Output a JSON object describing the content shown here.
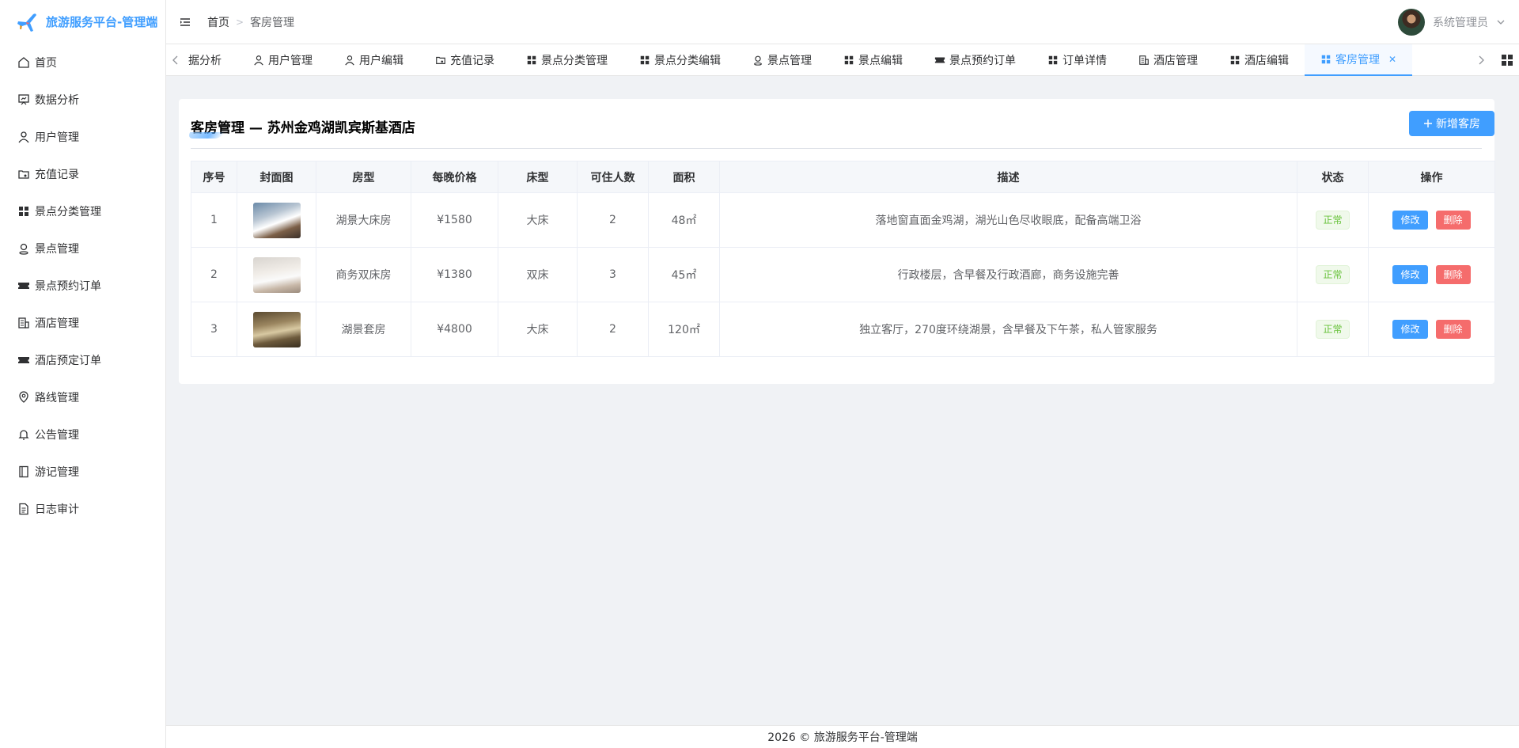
{
  "app": {
    "title": "旅游服务平台-管理端"
  },
  "sidebar": {
    "items": [
      {
        "label": "首页"
      },
      {
        "label": "数据分析"
      },
      {
        "label": "用户管理"
      },
      {
        "label": "充值记录"
      },
      {
        "label": "景点分类管理"
      },
      {
        "label": "景点管理"
      },
      {
        "label": "景点预约订单"
      },
      {
        "label": "酒店管理"
      },
      {
        "label": "酒店预定订单"
      },
      {
        "label": "路线管理"
      },
      {
        "label": "公告管理"
      },
      {
        "label": "游记管理"
      },
      {
        "label": "日志审计"
      }
    ]
  },
  "header": {
    "breadcrumb": {
      "home": "首页",
      "current": "客房管理"
    },
    "user": {
      "name": "系统管理员"
    }
  },
  "tabs": [
    {
      "label": "据分析"
    },
    {
      "label": "用户管理"
    },
    {
      "label": "用户编辑"
    },
    {
      "label": "充值记录"
    },
    {
      "label": "景点分类管理"
    },
    {
      "label": "景点分类编辑"
    },
    {
      "label": "景点管理"
    },
    {
      "label": "景点编辑"
    },
    {
      "label": "景点预约订单"
    },
    {
      "label": "订单详情"
    },
    {
      "label": "酒店管理"
    },
    {
      "label": "酒店编辑"
    },
    {
      "label": "客房管理",
      "active": true
    }
  ],
  "main": {
    "title": "客房管理 — 苏州金鸡湖凯宾斯基酒店",
    "add_button": "新增客房",
    "columns": [
      "序号",
      "封面图",
      "房型",
      "每晚价格",
      "床型",
      "可住人数",
      "面积",
      "描述",
      "状态",
      "操作"
    ],
    "rows": [
      {
        "index": "1",
        "type": "湖景大床房",
        "price": "¥1580",
        "bed": "大床",
        "capacity": "2",
        "area": "48㎡",
        "desc": "落地窗直面金鸡湖，湖光山色尽收眼底，配备高端卫浴",
        "status": "正常"
      },
      {
        "index": "2",
        "type": "商务双床房",
        "price": "¥1380",
        "bed": "双床",
        "capacity": "3",
        "area": "45㎡",
        "desc": "行政楼层，含早餐及行政酒廊，商务设施完善",
        "status": "正常"
      },
      {
        "index": "3",
        "type": "湖景套房",
        "price": "¥4800",
        "bed": "大床",
        "capacity": "2",
        "area": "120㎡",
        "desc": "独立客厅，270度环绕湖景，含早餐及下午茶，私人管家服务",
        "status": "正常"
      }
    ],
    "actions": {
      "edit": "修改",
      "delete": "删除"
    }
  },
  "footer": {
    "text": "2026 © 旅游服务平台-管理端"
  },
  "colors": {
    "primary": "#409eff",
    "danger": "#f56c6c",
    "success": "#67c23a"
  }
}
